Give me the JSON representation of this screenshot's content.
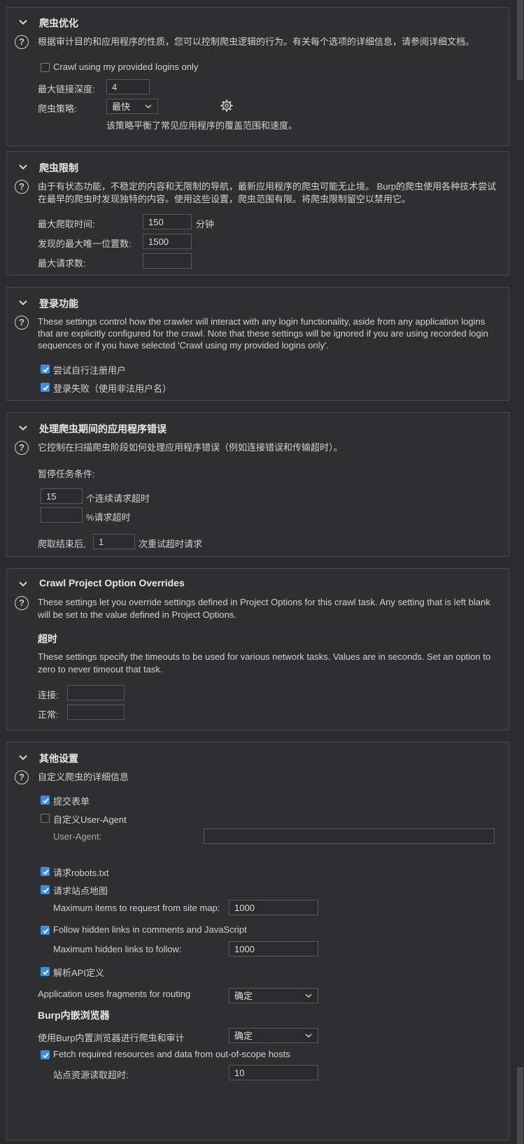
{
  "sections": {
    "crawl_opt": {
      "title": "爬虫优化",
      "desc": "根据审计目的和应用程序的性质，您可以控制爬虫逻辑的行为。有关每个选项的详细信息，请参阅详细文档。",
      "crawl_logins_label": "Crawl using my provided logins only",
      "crawl_logins_checked": false,
      "max_depth_label": "最大链接深度:",
      "max_depth_value": "4",
      "strategy_label": "爬虫策略:",
      "strategy_value": "最快",
      "strategy_note": "该策略平衡了常见应用程序的覆盖范围和速度。",
      "settings_icon": "gear-icon"
    },
    "crawl_limits": {
      "title": "爬虫限制",
      "desc": "由于有状态功能，不稳定的内容和无限制的导航，最新应用程序的爬虫可能无止境。 Burp的爬虫使用各种技术尝试在最早的爬虫时发现独特的内容。使用这些设置，爬虫范围有限。将爬虫限制留空以禁用它。",
      "max_time_label": "最大爬取时间:",
      "max_time_value": "150",
      "max_time_unit": "分钟",
      "max_locations_label": "发现的最大唯一位置数:",
      "max_locations_value": "1500",
      "max_requests_label": "最大请求数:",
      "max_requests_value": ""
    },
    "login": {
      "title": "登录功能",
      "desc": "These settings control how the crawler will interact with any login functionality, aside from any application logins that are explicitly configured for the crawl. Note that these settings will be ignored if you are using recorded login sequences or if you have selected 'Crawl using my provided logins only'.",
      "self_register_label": "尝试自行注册用户",
      "self_register_checked": true,
      "invalid_login_label": "登录失败（使用非法用户名）",
      "invalid_login_checked": true
    },
    "errors": {
      "title": "处理爬虫期间的应用程序错误",
      "desc": "它控制在扫描爬虫阶段如何处理应用程序错误（例如连接错误和传输超时）。",
      "pause_label": "暂停任务条件:",
      "consecutive_value": "15",
      "consecutive_label": "个连续请求超时",
      "percent_value": "",
      "percent_label": "%请求超时",
      "retry_prefix": "爬取结束后,",
      "retry_value": "1",
      "retry_suffix": "次重试超时请求"
    },
    "overrides": {
      "title": "Crawl Project Option Overrides",
      "desc": "These settings let you override settings defined in Project Options for this crawl task. Any setting that is left blank will be set to the value defined in Project Options.",
      "timeout_heading": "超时",
      "timeout_desc": "These settings specify the timeouts to be used for various network tasks. Values are in seconds. Set an option to zero to never timeout that task.",
      "connect_label": "连接:",
      "connect_value": "",
      "normal_label": "正常:",
      "normal_value": ""
    },
    "misc": {
      "title": "其他设置",
      "desc": "自定义爬虫的详细信息",
      "submit_forms_label": "提交表单",
      "submit_forms_checked": true,
      "custom_ua_label": "自定义User-Agent",
      "custom_ua_checked": false,
      "ua_field_label": "User-Agent:",
      "ua_value": "",
      "robots_label": "请求robots.txt",
      "robots_checked": true,
      "sitemap_label": "请求站点地图",
      "sitemap_checked": true,
      "sitemap_max_label": "Maximum items to request from site map:",
      "sitemap_max_value": "1000",
      "hidden_links_label": "Follow hidden links in comments and JavaScript",
      "hidden_links_checked": true,
      "hidden_max_label": "Maximum hidden links to follow:",
      "hidden_max_value": "1000",
      "api_label": "解析API定义",
      "api_checked": true,
      "fragments_label": "Application uses fragments for routing",
      "fragments_value": "确定",
      "browser_heading": "Burp内嵌浏览器",
      "use_browser_label": "使用Burp内置浏览器进行爬虫和审计",
      "use_browser_value": "确定",
      "fetch_label": "Fetch required resources and data from out-of-scope hosts",
      "fetch_checked": true,
      "resource_timeout_label": "站点资源读取超时:",
      "resource_timeout_value": "10"
    }
  },
  "colors": {
    "accent": "#3d8ee0",
    "background": "#2b2b2d",
    "border": "#4a4a4c"
  }
}
